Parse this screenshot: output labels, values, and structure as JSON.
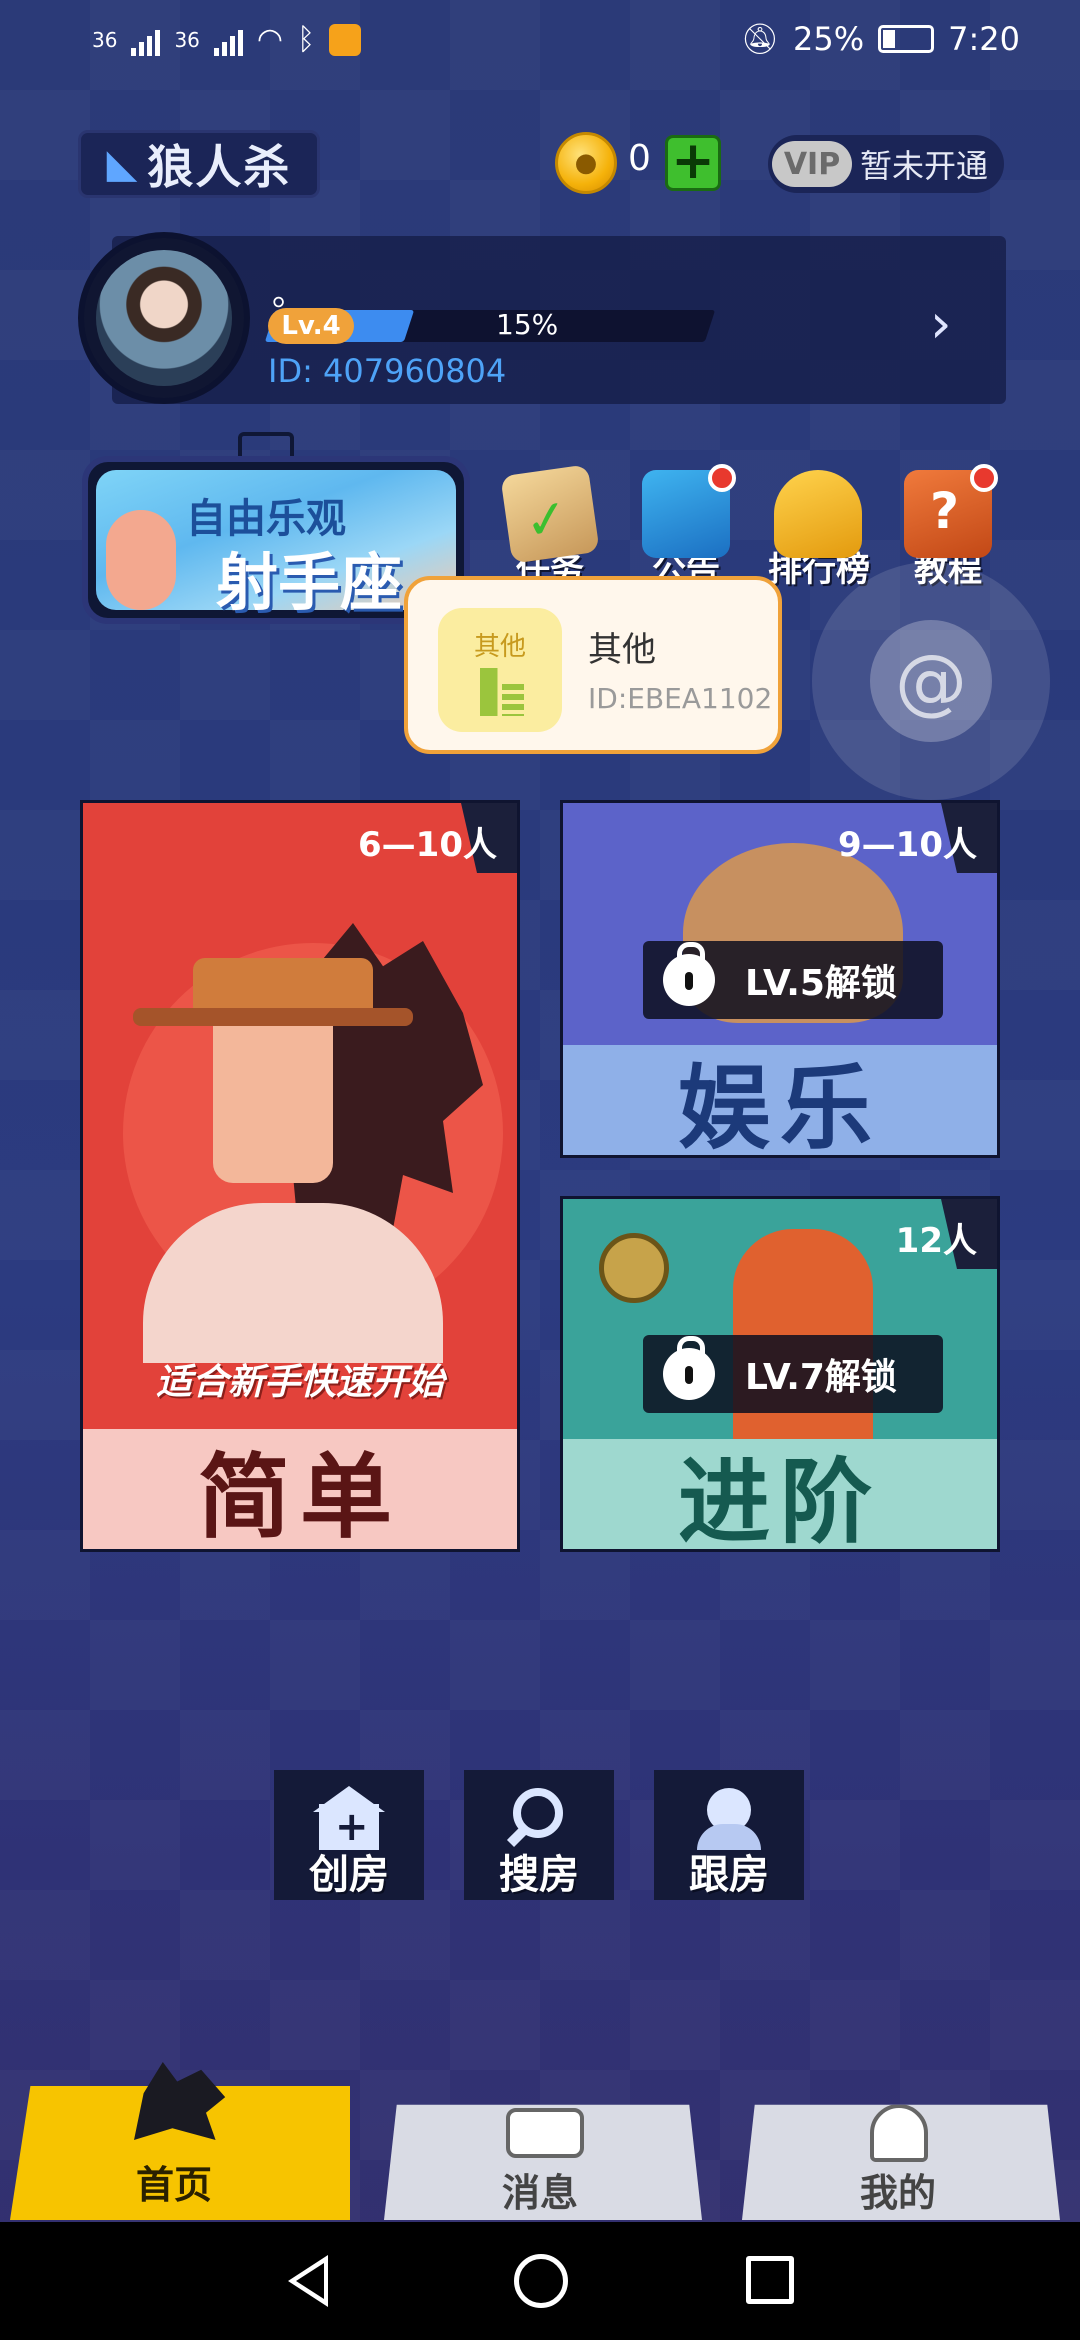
{
  "status_bar": {
    "network": "36",
    "battery": "25%",
    "time": "7:20"
  },
  "header": {
    "logo_text": "狼人杀",
    "coin_count": "0",
    "vip_badge": "VIP",
    "vip_status": "暂未开通"
  },
  "profile": {
    "nickname": "。",
    "level": "Lv.4",
    "progress_percent": "15%",
    "progress_fraction": 0.15,
    "user_id": "ID: 407960804"
  },
  "banner": {
    "subtitle": "自由乐观",
    "title": "射手座"
  },
  "quick_actions": [
    {
      "label": "任务",
      "icon": "scroll-check-icon"
    },
    {
      "label": "公告",
      "icon": "megaphone-icon"
    },
    {
      "label": "排行榜",
      "icon": "trophy-icon"
    },
    {
      "label": "教程",
      "icon": "book-question-icon"
    }
  ],
  "popup": {
    "icon_label": "其他",
    "title": "其他",
    "id": "ID:EBEA1102"
  },
  "modes": {
    "easy": {
      "players": "6—10人",
      "tagline": "适合新手快速开始",
      "name": "简单"
    },
    "fun": {
      "players": "9—10人",
      "lock": "LV.5解锁",
      "name": "娱乐"
    },
    "advanced": {
      "players": "12人",
      "lock": "LV.7解锁",
      "name": "进阶"
    }
  },
  "room_actions": {
    "create": "创房",
    "search": "搜房",
    "follow": "跟房"
  },
  "tabs": {
    "home": "首页",
    "messages": "消息",
    "me": "我的"
  },
  "colors": {
    "accent_yellow": "#f7c400",
    "level_badge": "#f0a23a",
    "id_blue": "#4ea3f7",
    "easy_card": "#e2423a",
    "fun_card": "#5c63c9",
    "advanced_card": "#3aa39a"
  }
}
